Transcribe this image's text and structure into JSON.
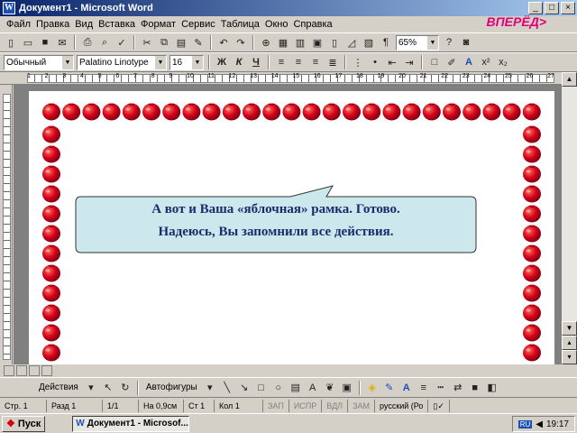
{
  "window": {
    "title": "Документ1 - Microsoft Word"
  },
  "menu": [
    "Файл",
    "Правка",
    "Вид",
    "Вставка",
    "Формат",
    "Сервис",
    "Таблица",
    "Окно",
    "Справка"
  ],
  "nav_label": "ВПЕРЁД",
  "toolbar": {
    "zoom": "65%"
  },
  "format": {
    "style": "Обычный",
    "font": "Palatino Linotype",
    "size": "16",
    "bold": "Ж",
    "italic": "К",
    "underline": "Ч"
  },
  "ruler_numbers": [
    "1",
    "2",
    "3",
    "4",
    "5",
    "6",
    "7",
    "8",
    "9",
    "10",
    "11",
    "12",
    "13",
    "14",
    "15",
    "16",
    "17",
    "18",
    "19",
    "20",
    "21",
    "22",
    "23",
    "24",
    "25",
    "26",
    "27"
  ],
  "callout": {
    "line1": "А вот и Ваша «яблочная» рамка. Готово.",
    "line2": "Надеюсь, Вы запомнили все действия."
  },
  "drawing": {
    "actions": "Действия",
    "autoshapes": "Автофигуры"
  },
  "status": {
    "page": "Стр. 1",
    "section": "Разд 1",
    "pages": "1/1",
    "position": "На 0,9см",
    "line": "Ст 1",
    "column": "Кол 1",
    "rec": "ЗАП",
    "trk": "ИСПР",
    "ext": "ВДЛ",
    "ovr": "ЗАМ",
    "language": "русский (Ро"
  },
  "taskbar": {
    "start": "Пуск",
    "task": "Документ1 - Microsof...",
    "lang": "RU",
    "clock": "19:17"
  },
  "colors": {
    "apple": "#d4001a",
    "callout_fill": "#cce8ec",
    "nav": "#e0007a"
  }
}
